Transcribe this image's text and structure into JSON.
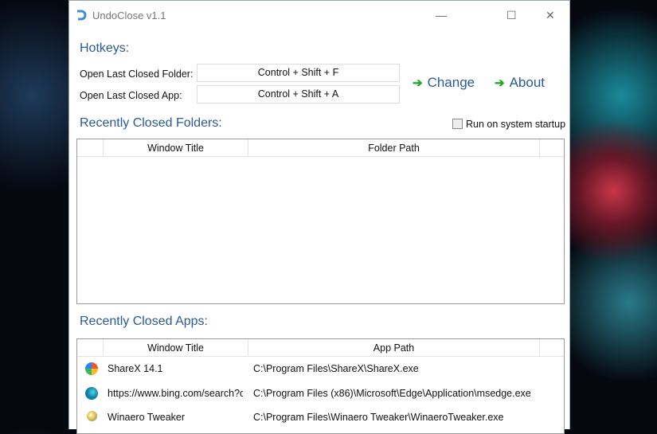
{
  "window": {
    "title": "UndoClose v1.1",
    "minimize": "—",
    "maximize": "☐",
    "close": "✕"
  },
  "hotkeys": {
    "heading": "Hotkeys:",
    "folder_label": "Open Last Closed Folder:",
    "folder_value": "Control + Shift + F",
    "app_label": "Open Last Closed App:",
    "app_value": "Control + Shift + A"
  },
  "links": {
    "arrow": "➔",
    "change": "Change",
    "about": "About"
  },
  "startup": {
    "label": "Run on system startup",
    "checked": false
  },
  "folders": {
    "heading": "Recently Closed Folders:",
    "columns": [
      "Window Title",
      "Folder Path"
    ],
    "rows": []
  },
  "apps": {
    "heading": "Recently Closed Apps:",
    "columns": [
      "Window Title",
      "App Path"
    ],
    "rows": [
      {
        "icon": "sharex-icon",
        "title": "ShareX 14.1",
        "path": "C:\\Program Files\\ShareX\\ShareX.exe"
      },
      {
        "icon": "edge-icon",
        "title": "https://www.bing.com/search?q",
        "path": "C:\\Program Files (x86)\\Microsoft\\Edge\\Application\\msedge.exe"
      },
      {
        "icon": "winaero-icon",
        "title": "Winaero Tweaker",
        "path": "C:\\Program Files\\Winaero Tweaker\\WinaeroTweaker.exe"
      }
    ]
  }
}
